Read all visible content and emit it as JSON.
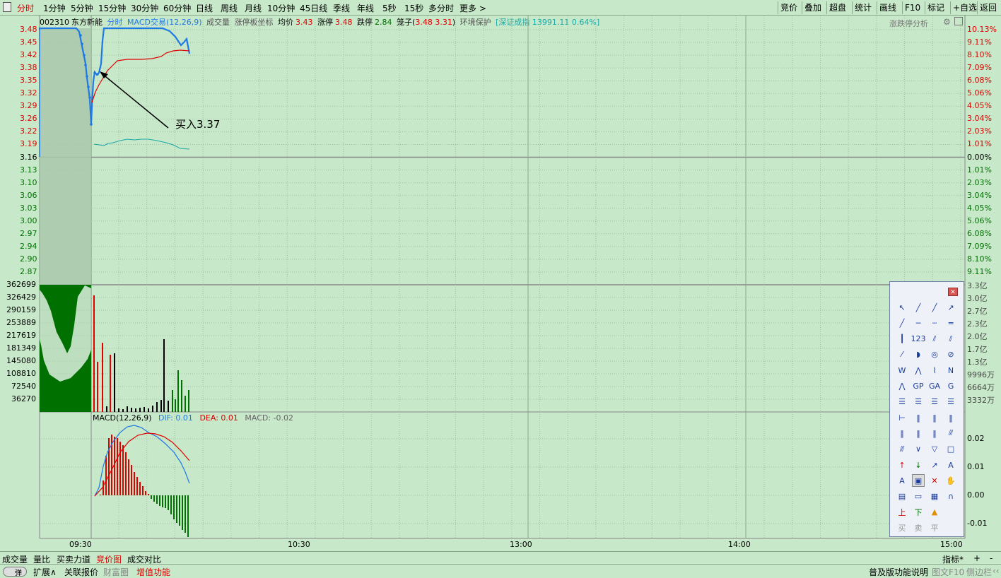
{
  "tabs": {
    "period_tabs": [
      "分时",
      "1分钟",
      "5分钟",
      "15分钟",
      "30分钟",
      "60分钟",
      "日线",
      "周线",
      "月线",
      "10分钟",
      "45日线",
      "季线",
      "年线",
      "5秒",
      "15秒",
      "多分时",
      "更多 >"
    ],
    "right_buttons": [
      "竞价",
      "叠加",
      "超盘",
      "统计",
      "画线",
      "F10",
      "标记",
      "+自选",
      "返回"
    ]
  },
  "info": {
    "code": "002310",
    "name": "东方新能",
    "mode": "分时",
    "indicator": "MACD交易(12,26,9)",
    "volume_label": "成交量",
    "coord_label": "涨停板坐标",
    "avg_label": "均价",
    "avg_value": "3.43",
    "limit_up_label": "涨停",
    "limit_up_value": "3.48",
    "limit_down_label": "跌停",
    "limit_down_value": "2.84",
    "cage_label": "笼子(",
    "cage_value": "3.48  3.31",
    "cage_close": ")",
    "protect_label": "环境保护",
    "index_label": "[深证成指",
    "index_value": "13991.11  0.64%]",
    "right_label": "涨跌停分析"
  },
  "price_axis": {
    "left": [
      "3.48",
      "3.45",
      "3.42",
      "3.38",
      "3.35",
      "3.32",
      "3.29",
      "3.26",
      "3.22",
      "3.19",
      "3.16",
      "3.13",
      "3.10",
      "3.06",
      "3.03",
      "3.00",
      "2.97",
      "2.94",
      "2.90",
      "2.87"
    ],
    "right": [
      "10.13%",
      "9.11%",
      "8.10%",
      "7.09%",
      "6.08%",
      "5.06%",
      "4.05%",
      "3.04%",
      "2.03%",
      "1.01%",
      "0.00%",
      "1.01%",
      "2.03%",
      "3.04%",
      "4.05%",
      "5.06%",
      "6.08%",
      "7.09%",
      "8.10%",
      "9.11%"
    ]
  },
  "volume_axis": {
    "left": [
      "362699",
      "326429",
      "290159",
      "253889",
      "217619",
      "181349",
      "145080",
      "108810",
      "72540",
      "36270"
    ],
    "right": [
      "3.3亿",
      "3.0亿",
      "2.7亿",
      "2.3亿",
      "2.0亿",
      "1.7亿",
      "1.3亿",
      "9996万",
      "6664万",
      "3332万"
    ]
  },
  "macd": {
    "title": "MACD(12,26,9)",
    "dif_label": "DIF: 0.01",
    "dea_label": "DEA: 0.01",
    "macd_label": "MACD: -0.02",
    "axis": [
      "0.02",
      "0.01",
      "0.00",
      "-0.01"
    ],
    "colors": {
      "dif": "#1e78e6",
      "dea": "#e00000",
      "up": "#e00000",
      "down": "#007000"
    }
  },
  "time_axis": [
    "09:30",
    "10:30",
    "13:00",
    "14:00",
    "15:00"
  ],
  "annotation": "买入3.37",
  "bottom_tabs": [
    "成交量",
    "量比",
    "买卖力道",
    "竞价图",
    "成交对比"
  ],
  "bottom_right": [
    "指标*",
    "+",
    "-"
  ],
  "status": {
    "toggle": "弹",
    "items": [
      "扩展∧",
      "关联报价",
      "财富圈",
      "增值功能"
    ],
    "right": [
      "普及版功能说明",
      "图文F10",
      "侧边栏",
      "‹‹"
    ]
  },
  "toolbox": {
    "rows": [
      [
        "cursor-icon",
        "line-icon",
        "ray-icon",
        "arrow-line-icon"
      ],
      [
        "segment-icon",
        "hline-icon",
        "hline2-icon",
        "hline3-icon"
      ],
      [
        "vline-icon",
        "text123-icon",
        "parallel-icon",
        "parallel2-icon"
      ],
      [
        "slash-icon",
        "arc-icon",
        "circle-icon",
        "circle-cross-icon"
      ],
      [
        "wave-w-icon",
        "wave-m-icon",
        "wave-up-icon",
        "wave-n-icon"
      ],
      [
        "zigzag-icon",
        "gp-icon",
        "ga-icon",
        "g-icon"
      ],
      [
        "fib-icon",
        "fib2-icon",
        "fib3-icon",
        "fib4-icon"
      ],
      [
        "period-icon",
        "lines-icon",
        "lines2-icon",
        "lines3-icon"
      ],
      [
        "bars-icon",
        "bars2-icon",
        "bars3-icon",
        "fan-icon"
      ],
      [
        "fan2-icon",
        "down-v-icon",
        "triangle-icon",
        "rect-icon"
      ],
      [
        "up-arrow-icon",
        "down-arrow-icon",
        "slant-arrow-icon",
        "text-a-icon"
      ],
      [
        "text-a2-icon",
        "square-icon",
        "delete-icon",
        "hand-icon"
      ],
      [
        "note-icon",
        "box-icon",
        "chart-icon",
        "curve-icon"
      ],
      [
        "up-text-icon",
        "down-text-icon",
        "triangle-color-icon",
        ""
      ],
      [
        "buy-icon",
        "sell-icon",
        "flat-icon",
        ""
      ]
    ],
    "text_cells": {
      "up-text": "上",
      "down-text": "下",
      "buy": "买",
      "sell": "卖",
      "flat": "平",
      "text-a": "A",
      "text-a2": "A"
    }
  }
}
